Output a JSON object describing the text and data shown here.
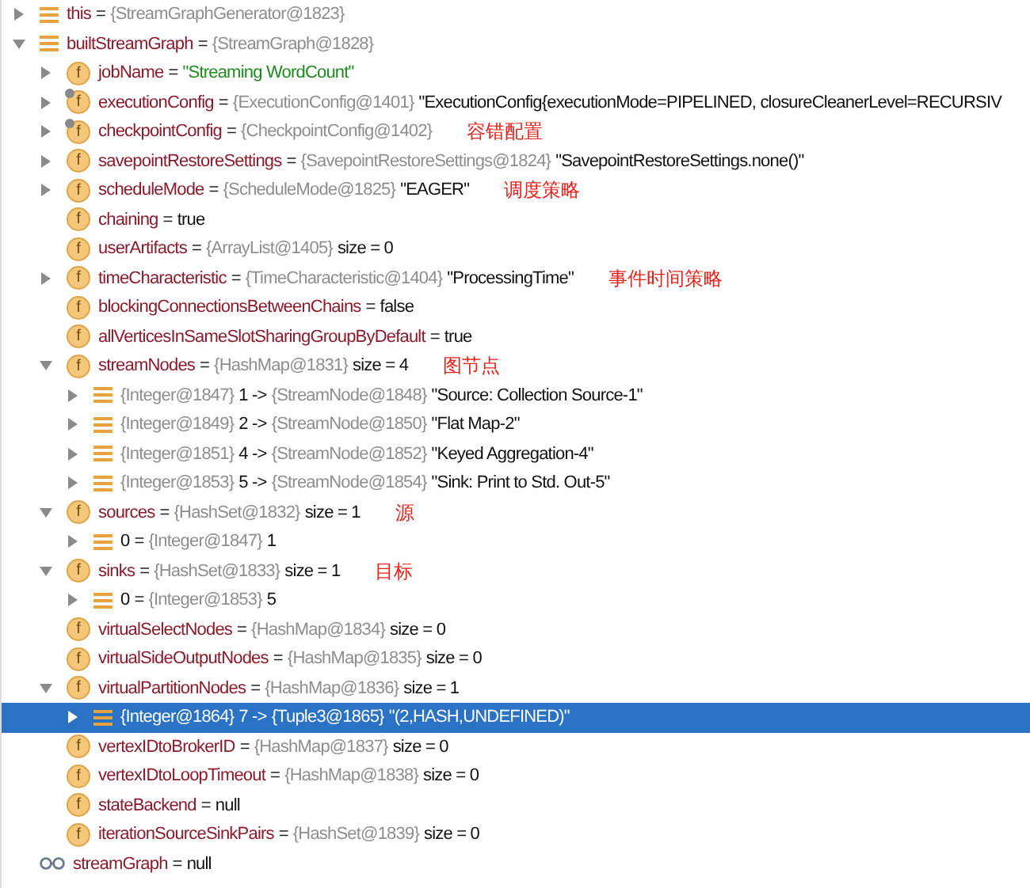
{
  "tree": [
    {
      "kind": "object",
      "expanded": false,
      "selected": false,
      "segments": [
        {
          "kind": "name",
          "text": "this"
        },
        {
          "kind": "op",
          "text": "="
        },
        {
          "kind": "ref",
          "text": "{StreamGraphGenerator@1823}"
        }
      ]
    },
    {
      "kind": "object",
      "expanded": true,
      "selected": false,
      "segments": [
        {
          "kind": "name",
          "text": "builtStreamGraph"
        },
        {
          "kind": "op",
          "text": "="
        },
        {
          "kind": "ref",
          "text": "{StreamGraph@1828}"
        }
      ],
      "children": [
        {
          "kind": "field",
          "badge": "f",
          "expanded": false,
          "selected": false,
          "segments": [
            {
              "kind": "name",
              "text": "jobName"
            },
            {
              "kind": "op",
              "text": "="
            },
            {
              "kind": "string",
              "text": "\"Streaming WordCount\""
            }
          ]
        },
        {
          "kind": "field_marked",
          "badge": "f",
          "expanded": false,
          "selected": false,
          "segments": [
            {
              "kind": "name",
              "text": "executionConfig"
            },
            {
              "kind": "op",
              "text": "="
            },
            {
              "kind": "ref",
              "text": "{ExecutionConfig@1401}"
            },
            {
              "kind": "value",
              "text": "\"ExecutionConfig{executionMode=PIPELINED, closureCleanerLevel=RECURSIV"
            }
          ]
        },
        {
          "kind": "field_marked",
          "badge": "f",
          "expanded": false,
          "selected": false,
          "segments": [
            {
              "kind": "name",
              "text": "checkpointConfig"
            },
            {
              "kind": "op",
              "text": "="
            },
            {
              "kind": "ref",
              "text": "{CheckpointConfig@1402}"
            }
          ],
          "note": "容错配置"
        },
        {
          "kind": "field",
          "badge": "f",
          "expanded": false,
          "selected": false,
          "segments": [
            {
              "kind": "name",
              "text": "savepointRestoreSettings"
            },
            {
              "kind": "op",
              "text": "="
            },
            {
              "kind": "ref",
              "text": "{SavepointRestoreSettings@1824}"
            },
            {
              "kind": "value",
              "text": "\"SavepointRestoreSettings.none()\""
            }
          ]
        },
        {
          "kind": "field",
          "badge": "f",
          "expanded": false,
          "selected": false,
          "segments": [
            {
              "kind": "name",
              "text": "scheduleMode"
            },
            {
              "kind": "op",
              "text": "="
            },
            {
              "kind": "ref",
              "text": "{ScheduleMode@1825}"
            },
            {
              "kind": "value",
              "text": "\"EAGER\""
            }
          ],
          "note": "调度策略"
        },
        {
          "kind": "field",
          "badge": "f",
          "selected": false,
          "segments": [
            {
              "kind": "name",
              "text": "chaining"
            },
            {
              "kind": "op",
              "text": "="
            },
            {
              "kind": "value",
              "text": "true"
            }
          ]
        },
        {
          "kind": "field",
          "badge": "f",
          "selected": false,
          "segments": [
            {
              "kind": "name",
              "text": "userArtifacts"
            },
            {
              "kind": "op",
              "text": "="
            },
            {
              "kind": "ref",
              "text": "{ArrayList@1405}"
            },
            {
              "kind": "value",
              "text": "size = 0"
            }
          ]
        },
        {
          "kind": "field",
          "badge": "f",
          "expanded": false,
          "selected": false,
          "segments": [
            {
              "kind": "name",
              "text": "timeCharacteristic"
            },
            {
              "kind": "op",
              "text": "="
            },
            {
              "kind": "ref",
              "text": "{TimeCharacteristic@1404}"
            },
            {
              "kind": "value",
              "text": "\"ProcessingTime\""
            }
          ],
          "note": "事件时间策略"
        },
        {
          "kind": "field",
          "badge": "f",
          "selected": false,
          "segments": [
            {
              "kind": "name",
              "text": "blockingConnectionsBetweenChains"
            },
            {
              "kind": "op",
              "text": "="
            },
            {
              "kind": "value",
              "text": "false"
            }
          ]
        },
        {
          "kind": "field",
          "badge": "f",
          "selected": false,
          "segments": [
            {
              "kind": "name",
              "text": "allVerticesInSameSlotSharingGroupByDefault"
            },
            {
              "kind": "op",
              "text": "="
            },
            {
              "kind": "value",
              "text": "true"
            }
          ]
        },
        {
          "kind": "field",
          "badge": "f",
          "expanded": true,
          "selected": false,
          "segments": [
            {
              "kind": "name",
              "text": "streamNodes"
            },
            {
              "kind": "op",
              "text": "="
            },
            {
              "kind": "ref",
              "text": "{HashMap@1831}"
            },
            {
              "kind": "value",
              "text": "size = 4"
            }
          ],
          "note": "图节点",
          "children": [
            {
              "kind": "object",
              "expanded": false,
              "selected": false,
              "segments": [
                {
                  "kind": "ref",
                  "text": "{Integer@1847}"
                },
                {
                  "kind": "value",
                  "text": "1 ->"
                },
                {
                  "kind": "ref",
                  "text": "{StreamNode@1848}"
                },
                {
                  "kind": "value",
                  "text": "\"Source: Collection Source-1\""
                }
              ]
            },
            {
              "kind": "object",
              "expanded": false,
              "selected": false,
              "segments": [
                {
                  "kind": "ref",
                  "text": "{Integer@1849}"
                },
                {
                  "kind": "value",
                  "text": "2 ->"
                },
                {
                  "kind": "ref",
                  "text": "{StreamNode@1850}"
                },
                {
                  "kind": "value",
                  "text": "\"Flat Map-2\""
                }
              ]
            },
            {
              "kind": "object",
              "expanded": false,
              "selected": false,
              "segments": [
                {
                  "kind": "ref",
                  "text": "{Integer@1851}"
                },
                {
                  "kind": "value",
                  "text": "4 ->"
                },
                {
                  "kind": "ref",
                  "text": "{StreamNode@1852}"
                },
                {
                  "kind": "value",
                  "text": "\"Keyed Aggregation-4\""
                }
              ]
            },
            {
              "kind": "object",
              "expanded": false,
              "selected": false,
              "segments": [
                {
                  "kind": "ref",
                  "text": "{Integer@1853}"
                },
                {
                  "kind": "value",
                  "text": "5 ->"
                },
                {
                  "kind": "ref",
                  "text": "{StreamNode@1854}"
                },
                {
                  "kind": "value",
                  "text": "\"Sink: Print to Std. Out-5\""
                }
              ]
            }
          ]
        },
        {
          "kind": "field",
          "badge": "f",
          "expanded": true,
          "selected": false,
          "segments": [
            {
              "kind": "name",
              "text": "sources"
            },
            {
              "kind": "op",
              "text": "="
            },
            {
              "kind": "ref",
              "text": "{HashSet@1832}"
            },
            {
              "kind": "value",
              "text": "size = 1"
            }
          ],
          "note": "源",
          "children": [
            {
              "kind": "object",
              "expanded": false,
              "selected": false,
              "segments": [
                {
                  "kind": "value",
                  "text": "0"
                },
                {
                  "kind": "op",
                  "text": "="
                },
                {
                  "kind": "ref",
                  "text": "{Integer@1847}"
                },
                {
                  "kind": "value",
                  "text": "1"
                }
              ]
            }
          ]
        },
        {
          "kind": "field",
          "badge": "f",
          "expanded": true,
          "selected": false,
          "segments": [
            {
              "kind": "name",
              "text": "sinks"
            },
            {
              "kind": "op",
              "text": "="
            },
            {
              "kind": "ref",
              "text": "{HashSet@1833}"
            },
            {
              "kind": "value",
              "text": "size = 1"
            }
          ],
          "note": "目标",
          "children": [
            {
              "kind": "object",
              "expanded": false,
              "selected": false,
              "segments": [
                {
                  "kind": "value",
                  "text": "0"
                },
                {
                  "kind": "op",
                  "text": "="
                },
                {
                  "kind": "ref",
                  "text": "{Integer@1853}"
                },
                {
                  "kind": "value",
                  "text": "5"
                }
              ]
            }
          ]
        },
        {
          "kind": "field",
          "badge": "f",
          "selected": false,
          "segments": [
            {
              "kind": "name",
              "text": "virtualSelectNodes"
            },
            {
              "kind": "op",
              "text": "="
            },
            {
              "kind": "ref",
              "text": "{HashMap@1834}"
            },
            {
              "kind": "value",
              "text": "size = 0"
            }
          ]
        },
        {
          "kind": "field",
          "badge": "f",
          "selected": false,
          "segments": [
            {
              "kind": "name",
              "text": "virtualSideOutputNodes"
            },
            {
              "kind": "op",
              "text": "="
            },
            {
              "kind": "ref",
              "text": "{HashMap@1835}"
            },
            {
              "kind": "value",
              "text": "size = 0"
            }
          ]
        },
        {
          "kind": "field",
          "badge": "f",
          "expanded": true,
          "selected": false,
          "segments": [
            {
              "kind": "name",
              "text": "virtualPartitionNodes"
            },
            {
              "kind": "op",
              "text": "="
            },
            {
              "kind": "ref",
              "text": "{HashMap@1836}"
            },
            {
              "kind": "value",
              "text": "size = 1"
            }
          ],
          "children": [
            {
              "kind": "object",
              "expanded": false,
              "selected": true,
              "segments": [
                {
                  "kind": "ref",
                  "text": "{Integer@1864}"
                },
                {
                  "kind": "value",
                  "text": "7 ->"
                },
                {
                  "kind": "ref",
                  "text": "{Tuple3@1865}"
                },
                {
                  "kind": "value",
                  "text": "\"(2,HASH,UNDEFINED)\""
                }
              ]
            }
          ]
        },
        {
          "kind": "field",
          "badge": "f",
          "selected": false,
          "segments": [
            {
              "kind": "name",
              "text": "vertexIDtoBrokerID"
            },
            {
              "kind": "op",
              "text": "="
            },
            {
              "kind": "ref",
              "text": "{HashMap@1837}"
            },
            {
              "kind": "value",
              "text": "size = 0"
            }
          ]
        },
        {
          "kind": "field",
          "badge": "f",
          "selected": false,
          "segments": [
            {
              "kind": "name",
              "text": "vertexIDtoLoopTimeout"
            },
            {
              "kind": "op",
              "text": "="
            },
            {
              "kind": "ref",
              "text": "{HashMap@1838}"
            },
            {
              "kind": "value",
              "text": "size = 0"
            }
          ]
        },
        {
          "kind": "field",
          "badge": "f",
          "selected": false,
          "segments": [
            {
              "kind": "name",
              "text": "stateBackend"
            },
            {
              "kind": "op",
              "text": "="
            },
            {
              "kind": "value",
              "text": "null"
            }
          ]
        },
        {
          "kind": "field",
          "badge": "f",
          "selected": false,
          "segments": [
            {
              "kind": "name",
              "text": "iterationSourceSinkPairs"
            },
            {
              "kind": "op",
              "text": "="
            },
            {
              "kind": "ref",
              "text": "{HashSet@1839}"
            },
            {
              "kind": "value",
              "text": "size = 0"
            }
          ]
        }
      ]
    },
    {
      "kind": "watch",
      "selected": false,
      "segments": [
        {
          "kind": "name",
          "text": "streamGraph"
        },
        {
          "kind": "op",
          "text": "="
        },
        {
          "kind": "value",
          "text": "null"
        }
      ]
    }
  ]
}
